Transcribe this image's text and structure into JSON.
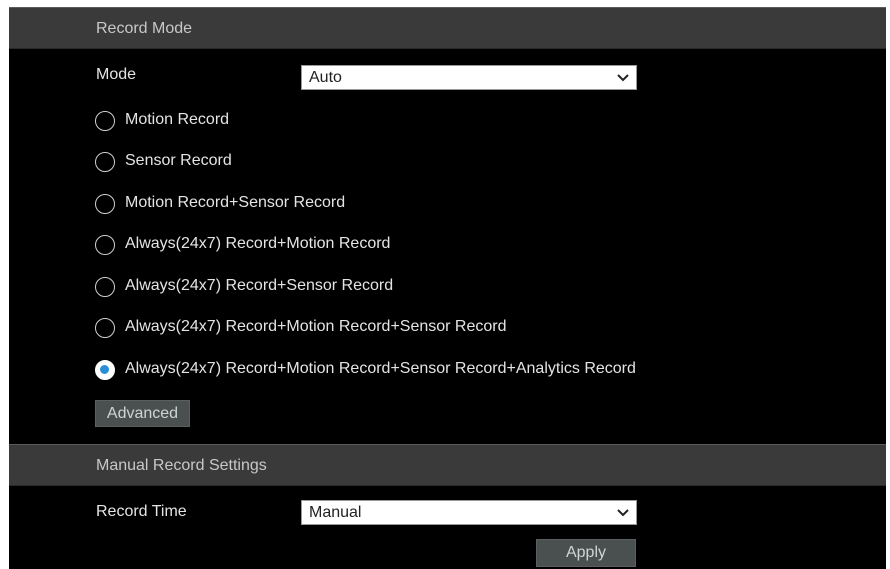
{
  "record_mode": {
    "section_title": "Record Mode",
    "mode_label": "Mode",
    "mode_value": "Auto",
    "options": [
      {
        "label": "Motion Record",
        "checked": false
      },
      {
        "label": "Sensor Record",
        "checked": false
      },
      {
        "label": "Motion Record+Sensor Record",
        "checked": false
      },
      {
        "label": "Always(24x7) Record+Motion Record",
        "checked": false
      },
      {
        "label": "Always(24x7) Record+Sensor Record",
        "checked": false
      },
      {
        "label": "Always(24x7) Record+Motion Record+Sensor Record",
        "checked": false
      },
      {
        "label": "Always(24x7) Record+Motion Record+Sensor Record+Analytics Record",
        "checked": true
      }
    ],
    "advanced_label": "Advanced"
  },
  "manual": {
    "section_title": "Manual Record Settings",
    "record_time_label": "Record Time",
    "record_time_value": "Manual",
    "apply_label": "Apply"
  },
  "colors": {
    "panel_bg": "#000000",
    "header_bg": "#3a3a3a",
    "radio_accent": "#2a8fd6",
    "button_bg": "#4a4f50"
  }
}
